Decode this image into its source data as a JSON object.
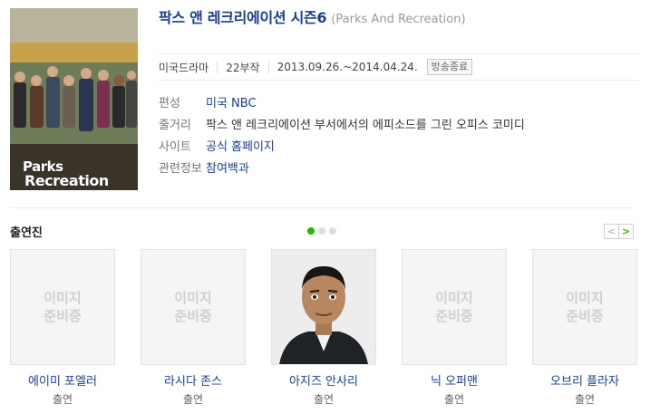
{
  "poster": {
    "title_line1": "Parks",
    "title_line2": "Recreation"
  },
  "title": {
    "korean": "팍스 앤 레크리에이션 시즌6",
    "english": "(Parks And Recreation)"
  },
  "meta": {
    "genre": "미국드라마",
    "episodes": "22부작",
    "dates": "2013.09.26.~2014.04.24.",
    "status_badge": "방송종료"
  },
  "info": [
    {
      "key": "편성",
      "value": "미국 NBC"
    },
    {
      "key": "줄거리",
      "value": "팍스 앤 레크리에이션 부서에서의 에피소드를 그린 오피스 코미디"
    },
    {
      "key": "사이트",
      "value": "공식 홈페이지"
    },
    {
      "key": "관련정보",
      "value": "참여백과"
    }
  ],
  "cast_section": {
    "label": "출연진",
    "prev": "<",
    "next": ">"
  },
  "placeholder": {
    "line1": "이미지",
    "line2": "준비중"
  },
  "cast": [
    {
      "name": "에이미 포엘러",
      "role": "출연"
    },
    {
      "name": "라시다 존스",
      "role": "출연"
    },
    {
      "name": "아지즈 안사리",
      "role": "출연"
    },
    {
      "name": "닉 오퍼맨",
      "role": "출연"
    },
    {
      "name": "오브리 플라자",
      "role": "출연"
    }
  ]
}
